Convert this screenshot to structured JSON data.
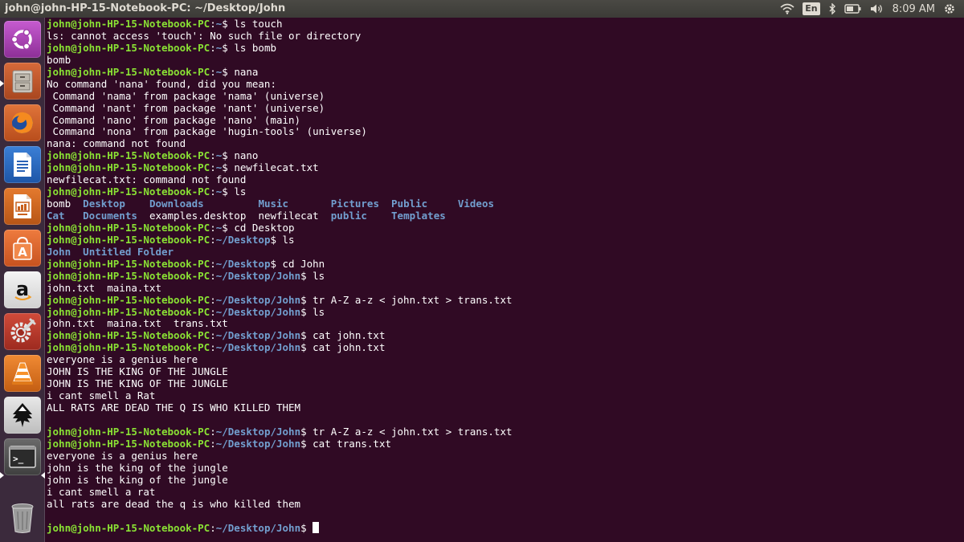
{
  "window": {
    "title": "john@john-HP-15-Notebook-PC: ~/Desktop/John"
  },
  "panel": {
    "keyboard_lang": "En",
    "clock": "8:09 AM",
    "icons": [
      "wifi-icon",
      "keyboard-layout-indicator",
      "bluetooth-icon",
      "battery-icon",
      "volume-icon",
      "settings-gear-icon"
    ]
  },
  "launcher": {
    "items": [
      {
        "name": "ubuntu-dash",
        "icon": "ubuntu-logo-icon"
      },
      {
        "name": "files",
        "icon": "file-cabinet-icon"
      },
      {
        "name": "firefox",
        "icon": "firefox-icon"
      },
      {
        "name": "libreoffice-writer",
        "icon": "writer-document-icon"
      },
      {
        "name": "libreoffice-impress",
        "icon": "impress-presentation-icon"
      },
      {
        "name": "ubuntu-software",
        "icon": "shopping-bag-icon",
        "glyph": "A"
      },
      {
        "name": "amazon",
        "icon": "amazon-icon",
        "glyph": "a"
      },
      {
        "name": "system-settings",
        "icon": "settings-tools-icon"
      },
      {
        "name": "vlc",
        "icon": "vlc-cone-icon"
      },
      {
        "name": "inkscape",
        "icon": "inkscape-icon"
      },
      {
        "name": "terminal",
        "icon": "terminal-icon",
        "glyph": ">_"
      },
      {
        "name": "trash",
        "icon": "trash-icon"
      }
    ]
  },
  "terminal": {
    "lines": [
      {
        "type": "prompt",
        "user": "john@john-HP-15-Notebook-PC",
        "path": "~",
        "cmd": "ls touch"
      },
      {
        "type": "out",
        "text": "ls: cannot access 'touch': No such file or directory"
      },
      {
        "type": "prompt",
        "user": "john@john-HP-15-Notebook-PC",
        "path": "~",
        "cmd": "ls bomb"
      },
      {
        "type": "out",
        "text": "bomb"
      },
      {
        "type": "prompt",
        "user": "john@john-HP-15-Notebook-PC",
        "path": "~",
        "cmd": "nana"
      },
      {
        "type": "out",
        "text": "No command 'nana' found, did you mean:"
      },
      {
        "type": "out",
        "text": " Command 'nama' from package 'nama' (universe)"
      },
      {
        "type": "out",
        "text": " Command 'nant' from package 'nant' (universe)"
      },
      {
        "type": "out",
        "text": " Command 'nano' from package 'nano' (main)"
      },
      {
        "type": "out",
        "text": " Command 'nona' from package 'hugin-tools' (universe)"
      },
      {
        "type": "out",
        "text": "nana: command not found"
      },
      {
        "type": "prompt",
        "user": "john@john-HP-15-Notebook-PC",
        "path": "~",
        "cmd": "nano"
      },
      {
        "type": "prompt",
        "user": "john@john-HP-15-Notebook-PC",
        "path": "~",
        "cmd": "newfilecat.txt"
      },
      {
        "type": "out",
        "text": "newfilecat.txt: command not found"
      },
      {
        "type": "prompt",
        "user": "john@john-HP-15-Notebook-PC",
        "path": "~",
        "cmd": "ls"
      },
      {
        "type": "ls",
        "items": [
          {
            "t": "bomb",
            "d": false
          },
          {
            "t": "  ",
            "d": false
          },
          {
            "t": "Desktop",
            "d": true
          },
          {
            "t": "    ",
            "d": false
          },
          {
            "t": "Downloads",
            "d": true
          },
          {
            "t": "         ",
            "d": false
          },
          {
            "t": "Music",
            "d": true
          },
          {
            "t": "       ",
            "d": false
          },
          {
            "t": "Pictures",
            "d": true
          },
          {
            "t": "  ",
            "d": false
          },
          {
            "t": "Public",
            "d": true
          },
          {
            "t": "     ",
            "d": false
          },
          {
            "t": "Videos",
            "d": true
          }
        ]
      },
      {
        "type": "ls",
        "items": [
          {
            "t": "Cat",
            "d": true
          },
          {
            "t": "   ",
            "d": false
          },
          {
            "t": "Documents",
            "d": true
          },
          {
            "t": "  ",
            "d": false
          },
          {
            "t": "examples.desktop",
            "d": false
          },
          {
            "t": "  ",
            "d": false
          },
          {
            "t": "newfilecat",
            "d": false
          },
          {
            "t": "  ",
            "d": false
          },
          {
            "t": "public",
            "d": true
          },
          {
            "t": "    ",
            "d": false
          },
          {
            "t": "Templates",
            "d": true
          }
        ]
      },
      {
        "type": "prompt",
        "user": "john@john-HP-15-Notebook-PC",
        "path": "~",
        "cmd": "cd Desktop"
      },
      {
        "type": "prompt",
        "user": "john@john-HP-15-Notebook-PC",
        "path": "~/Desktop",
        "cmd": "ls"
      },
      {
        "type": "ls",
        "items": [
          {
            "t": "John",
            "d": true
          },
          {
            "t": "  ",
            "d": false
          },
          {
            "t": "Untitled Folder",
            "d": true
          }
        ]
      },
      {
        "type": "prompt",
        "user": "john@john-HP-15-Notebook-PC",
        "path": "~/Desktop",
        "cmd": "cd John"
      },
      {
        "type": "prompt",
        "user": "john@john-HP-15-Notebook-PC",
        "path": "~/Desktop/John",
        "cmd": "ls"
      },
      {
        "type": "out",
        "text": "john.txt  maina.txt"
      },
      {
        "type": "prompt",
        "user": "john@john-HP-15-Notebook-PC",
        "path": "~/Desktop/John",
        "cmd": "tr A-Z a-z < john.txt > trans.txt"
      },
      {
        "type": "prompt",
        "user": "john@john-HP-15-Notebook-PC",
        "path": "~/Desktop/John",
        "cmd": "ls"
      },
      {
        "type": "out",
        "text": "john.txt  maina.txt  trans.txt"
      },
      {
        "type": "prompt",
        "user": "john@john-HP-15-Notebook-PC",
        "path": "~/Desktop/John",
        "cmd": "cat john.txt"
      },
      {
        "type": "prompt",
        "user": "john@john-HP-15-Notebook-PC",
        "path": "~/Desktop/John",
        "cmd": "cat john.txt"
      },
      {
        "type": "out",
        "text": "everyone is a genius here"
      },
      {
        "type": "out",
        "text": "JOHN IS THE KING OF THE JUNGLE"
      },
      {
        "type": "out",
        "text": "JOHN IS THE KING OF THE JUNGLE"
      },
      {
        "type": "out",
        "text": "i cant smell a Rat"
      },
      {
        "type": "out",
        "text": "ALL RATS ARE DEAD THE Q IS WHO KILLED THEM"
      },
      {
        "type": "out",
        "text": ""
      },
      {
        "type": "prompt",
        "user": "john@john-HP-15-Notebook-PC",
        "path": "~/Desktop/John",
        "cmd": "tr A-Z a-z < john.txt > trans.txt"
      },
      {
        "type": "prompt",
        "user": "john@john-HP-15-Notebook-PC",
        "path": "~/Desktop/John",
        "cmd": "cat trans.txt"
      },
      {
        "type": "out",
        "text": "everyone is a genius here"
      },
      {
        "type": "out",
        "text": "john is the king of the jungle"
      },
      {
        "type": "out",
        "text": "john is the king of the jungle"
      },
      {
        "type": "out",
        "text": "i cant smell a rat"
      },
      {
        "type": "out",
        "text": "all rats are dead the q is who killed them"
      },
      {
        "type": "out",
        "text": ""
      },
      {
        "type": "prompt",
        "user": "john@john-HP-15-Notebook-PC",
        "path": "~/Desktop/John",
        "cmd": "",
        "cursor": true
      }
    ]
  },
  "colors": {
    "terminal_bg": "#300a24",
    "prompt_user": "#8ae234",
    "prompt_path": "#729fcf",
    "directory": "#729fcf",
    "text": "#ffffff",
    "panel_bg": "#3c3b37"
  }
}
